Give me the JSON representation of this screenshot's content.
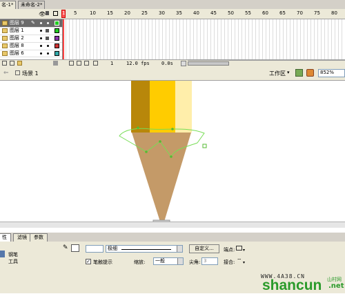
{
  "doc_tabs": [
    "名-1*",
    "未命名-2*"
  ],
  "timeline": {
    "ruler": [
      "5",
      "10",
      "15",
      "20",
      "25",
      "30",
      "35",
      "40",
      "45",
      "50",
      "55",
      "60",
      "65",
      "70",
      "75",
      "80"
    ],
    "playhead": "1",
    "layers": [
      {
        "name": "图层 9",
        "selected": true,
        "color": "#22cc22"
      },
      {
        "name": "图层 1",
        "selected": false,
        "color": "#22cc22"
      },
      {
        "name": "图层 2",
        "selected": false,
        "color": "#8833aa"
      },
      {
        "name": "图层 8",
        "selected": false,
        "color": "#cc3333"
      },
      {
        "name": "图层 6",
        "selected": false,
        "color": "#33aaaa"
      }
    ],
    "frame": "1",
    "fps": "12.0 fps",
    "time": "0.0s"
  },
  "scene": {
    "name": "场景 1",
    "workspace": "工作区",
    "zoom": "852%"
  },
  "panel_tabs": [
    "性",
    "滤镜",
    "参数"
  ],
  "properties": {
    "tool_line1": "钢笔",
    "tool_line2": "工具",
    "stroke_width": "",
    "stroke_style": "极细",
    "custom_button": "自定义...",
    "cap_label": "端点:",
    "stroke_hint_label": "笔触提示",
    "scale_label": "缩放:",
    "scale_value": "一般",
    "miter_label": "尖角:",
    "miter_value": "3",
    "join_label": "接合:"
  },
  "watermark": {
    "brand": "shancun",
    "net": ".net",
    "cn_text": "山村网",
    "url_text": "WWW.4A38.CN"
  },
  "colors": {
    "pencil_dark": "#b8870a",
    "pencil_mid": "#ffcc00",
    "pencil_light": "#ffeeaa",
    "cone": "#c49a68",
    "path": "#77dd55"
  }
}
